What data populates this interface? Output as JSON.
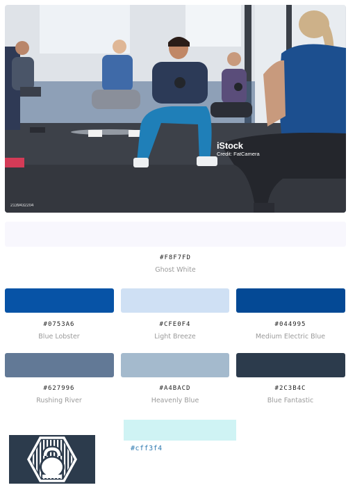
{
  "photo": {
    "watermark": "iStock",
    "credit": "Credit: FatCamera",
    "stock_id": "2139432204"
  },
  "palette": [
    {
      "hex": "#F8F7FD",
      "name": "Ghost White",
      "color": "#f8f7fd"
    },
    {
      "hex": "#0753A6",
      "name": "Blue Lobster",
      "color": "#0753a6"
    },
    {
      "hex": "#CFE0F4",
      "name": "Light Breeze",
      "color": "#cfe0f4"
    },
    {
      "hex": "#044995",
      "name": "Medium Electric Blue",
      "color": "#044995"
    },
    {
      "hex": "#627996",
      "name": "Rushing River",
      "color": "#627996"
    },
    {
      "hex": "#A4BACD",
      "name": "Heavenly Blue",
      "color": "#a4bacd"
    },
    {
      "hex": "#2C3B4C",
      "name": "Blue Fantastic",
      "color": "#2c3b4c"
    }
  ],
  "extra": {
    "hex": "#cff3f4",
    "color": "#cff3f4"
  },
  "logo": {
    "icon": "kettlebell-hexagon-icon",
    "background": "#2c3b4c"
  }
}
